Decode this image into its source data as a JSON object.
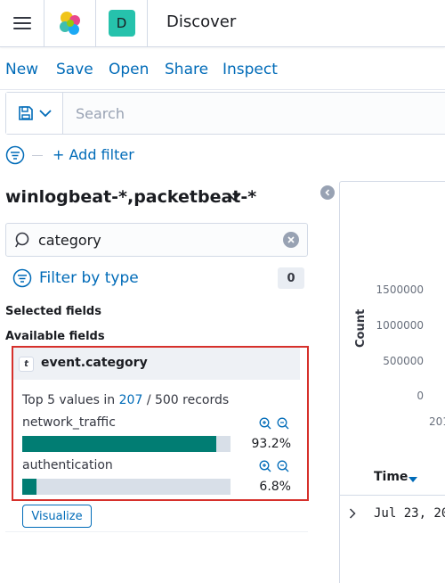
{
  "header": {
    "breadcrumb": "Discover",
    "space_initial": "D"
  },
  "topnav": {
    "items": [
      "New",
      "Save",
      "Open",
      "Share",
      "Inspect"
    ]
  },
  "query": {
    "placeholder": "Search"
  },
  "filters": {
    "add_label": "+ Add filter"
  },
  "sidebar": {
    "index_pattern": "winlogbeat-*,packetbeat-*",
    "field_search_value": "category",
    "filter_by_type_label": "Filter by type",
    "filter_count": "0",
    "selected_fields_title": "Selected fields",
    "available_fields_title": "Available fields"
  },
  "field_details": {
    "type_token": "t",
    "field_name": "event.category",
    "summary_prefix": "Top 5 values in ",
    "summary_count": "207",
    "summary_suffix": " / 500 records",
    "values": [
      {
        "name": "network_traffic",
        "percent_label": "93.2%",
        "fraction": 0.932
      },
      {
        "name": "authentication",
        "percent_label": "6.8%",
        "fraction": 0.068
      }
    ],
    "visualize_label": "Visualize"
  },
  "chart": {
    "ylabel": "Count",
    "yticks": [
      "1500000",
      "1000000",
      "500000",
      "0"
    ],
    "xtick_partial": "201"
  },
  "table": {
    "time_header": "Time",
    "first_row_time": "Jul 23, 20"
  },
  "colors": {
    "accent": "#006bb8",
    "bar": "#017d73",
    "highlight_border": "#d6302b"
  },
  "icons": [
    "menu-icon",
    "elastic-logo",
    "save-query-icon",
    "chevron-down-icon",
    "filter-options-icon",
    "search-icon",
    "clear-icon",
    "zoom-in-icon",
    "zoom-out-icon",
    "collapse-arrow-icon",
    "sort-desc-icon",
    "expand-row-icon"
  ]
}
